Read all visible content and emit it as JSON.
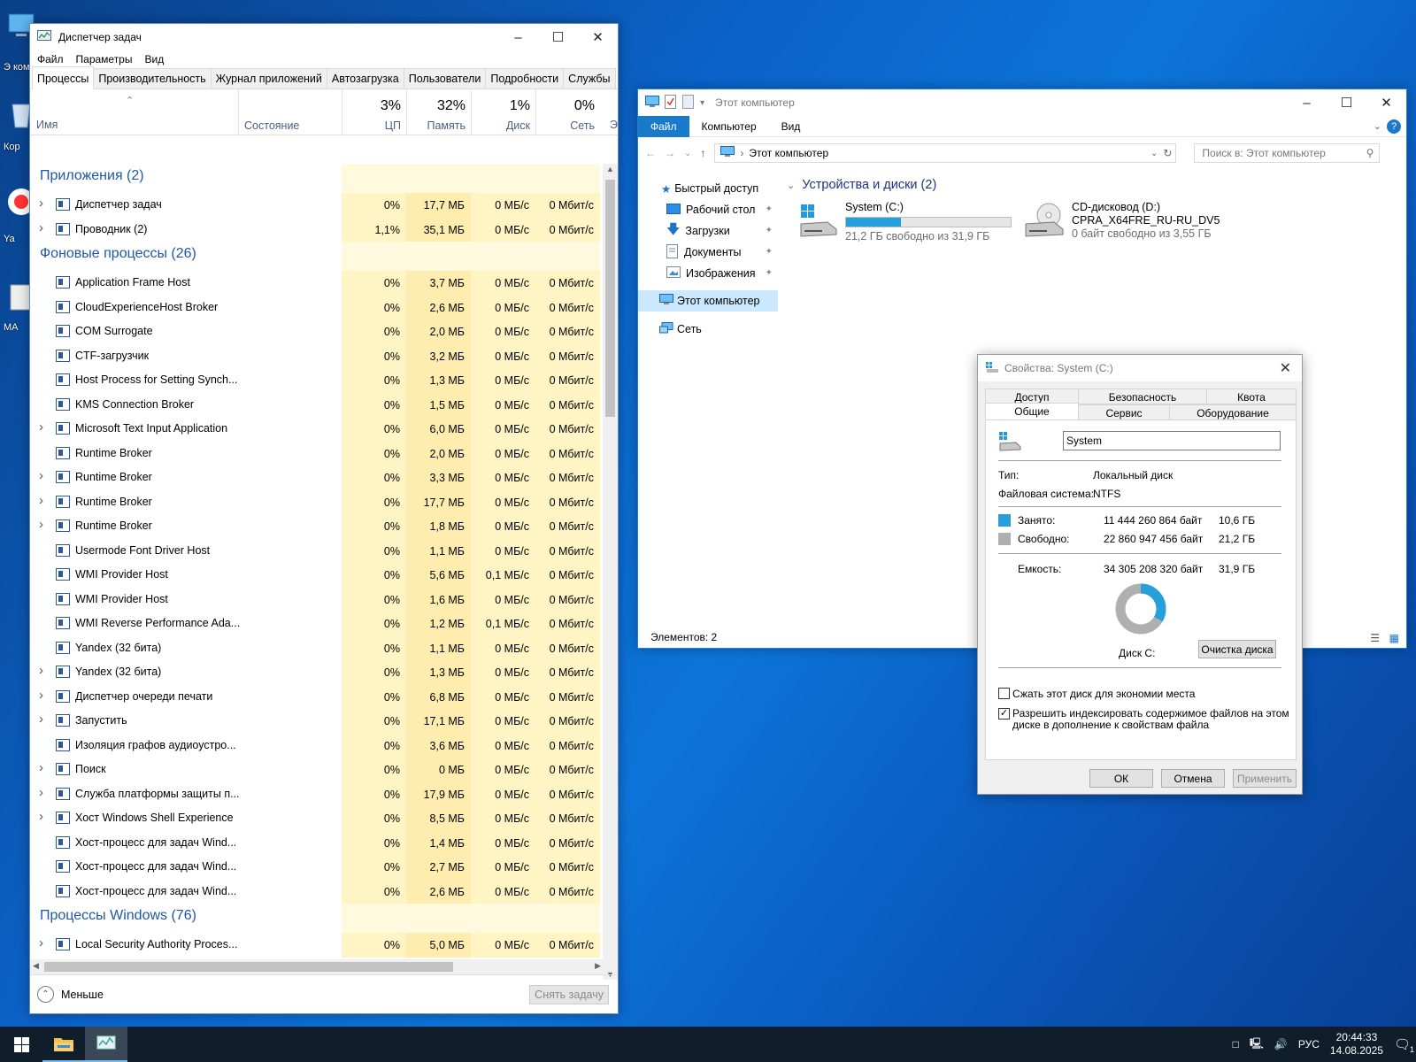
{
  "desktop": {
    "icons": [
      {
        "label": "Э комп"
      },
      {
        "label": "Кор"
      },
      {
        "label": "Ya"
      },
      {
        "label": "MA"
      }
    ]
  },
  "taskmgr": {
    "title": "Диспетчер задач",
    "menu": [
      "Файл",
      "Параметры",
      "Вид"
    ],
    "tabs": [
      "Процессы",
      "Производительность",
      "Журнал приложений",
      "Автозагрузка",
      "Пользователи",
      "Подробности",
      "Службы"
    ],
    "columns": {
      "name": "Имя",
      "status": "Состояние",
      "cpu_pct": "3%",
      "cpu": "ЦП",
      "mem_pct": "32%",
      "mem": "Память",
      "disk_pct": "1%",
      "disk": "Диск",
      "net_pct": "0%",
      "net": "Сеть",
      "more": "Э"
    },
    "groups": {
      "apps": "Приложения (2)",
      "background": "Фоновые процессы (26)",
      "windows": "Процессы Windows (76)"
    },
    "apps": [
      {
        "name": "Диспетчер задач",
        "cpu": "0%",
        "mem": "17,7 МБ",
        "disk": "0 МБ/с",
        "net": "0 Мбит/с",
        "expand": true
      },
      {
        "name": "Проводник (2)",
        "cpu": "1,1%",
        "mem": "35,1 МБ",
        "disk": "0 МБ/с",
        "net": "0 Мбит/с",
        "expand": true
      }
    ],
    "background": [
      {
        "name": "Application Frame Host",
        "cpu": "0%",
        "mem": "3,7 МБ",
        "disk": "0 МБ/с",
        "net": "0 Мбит/с",
        "expand": false
      },
      {
        "name": "CloudExperienceHost Broker",
        "cpu": "0%",
        "mem": "2,6 МБ",
        "disk": "0 МБ/с",
        "net": "0 Мбит/с",
        "expand": false
      },
      {
        "name": "COM Surrogate",
        "cpu": "0%",
        "mem": "2,0 МБ",
        "disk": "0 МБ/с",
        "net": "0 Мбит/с",
        "expand": false
      },
      {
        "name": "CTF-загрузчик",
        "cpu": "0%",
        "mem": "3,2 МБ",
        "disk": "0 МБ/с",
        "net": "0 Мбит/с",
        "expand": false
      },
      {
        "name": "Host Process for Setting Synch...",
        "cpu": "0%",
        "mem": "1,3 МБ",
        "disk": "0 МБ/с",
        "net": "0 Мбит/с",
        "expand": false
      },
      {
        "name": "KMS Connection Broker",
        "cpu": "0%",
        "mem": "1,5 МБ",
        "disk": "0 МБ/с",
        "net": "0 Мбит/с",
        "expand": false
      },
      {
        "name": "Microsoft Text Input Application",
        "cpu": "0%",
        "mem": "6,0 МБ",
        "disk": "0 МБ/с",
        "net": "0 Мбит/с",
        "expand": true
      },
      {
        "name": "Runtime Broker",
        "cpu": "0%",
        "mem": "2,0 МБ",
        "disk": "0 МБ/с",
        "net": "0 Мбит/с",
        "expand": false
      },
      {
        "name": "Runtime Broker",
        "cpu": "0%",
        "mem": "3,3 МБ",
        "disk": "0 МБ/с",
        "net": "0 Мбит/с",
        "expand": true
      },
      {
        "name": "Runtime Broker",
        "cpu": "0%",
        "mem": "17,7 МБ",
        "disk": "0 МБ/с",
        "net": "0 Мбит/с",
        "expand": true
      },
      {
        "name": "Runtime Broker",
        "cpu": "0%",
        "mem": "1,8 МБ",
        "disk": "0 МБ/с",
        "net": "0 Мбит/с",
        "expand": true
      },
      {
        "name": "Usermode Font Driver Host",
        "cpu": "0%",
        "mem": "1,1 МБ",
        "disk": "0 МБ/с",
        "net": "0 Мбит/с",
        "expand": false
      },
      {
        "name": "WMI Provider Host",
        "cpu": "0%",
        "mem": "5,6 МБ",
        "disk": "0,1 МБ/с",
        "net": "0 Мбит/с",
        "expand": false
      },
      {
        "name": "WMI Provider Host",
        "cpu": "0%",
        "mem": "1,6 МБ",
        "disk": "0 МБ/с",
        "net": "0 Мбит/с",
        "expand": false
      },
      {
        "name": "WMI Reverse Performance Ada...",
        "cpu": "0%",
        "mem": "1,2 МБ",
        "disk": "0,1 МБ/с",
        "net": "0 Мбит/с",
        "expand": false
      },
      {
        "name": "Yandex (32 бита)",
        "cpu": "0%",
        "mem": "1,1 МБ",
        "disk": "0 МБ/с",
        "net": "0 Мбит/с",
        "expand": false
      },
      {
        "name": "Yandex (32 бита)",
        "cpu": "0%",
        "mem": "1,3 МБ",
        "disk": "0 МБ/с",
        "net": "0 Мбит/с",
        "expand": true
      },
      {
        "name": "Диспетчер очереди печати",
        "cpu": "0%",
        "mem": "6,8 МБ",
        "disk": "0 МБ/с",
        "net": "0 Мбит/с",
        "expand": true
      },
      {
        "name": "Запустить",
        "cpu": "0%",
        "mem": "17,1 МБ",
        "disk": "0 МБ/с",
        "net": "0 Мбит/с",
        "expand": true
      },
      {
        "name": "Изоляция графов аудиоустро...",
        "cpu": "0%",
        "mem": "3,6 МБ",
        "disk": "0 МБ/с",
        "net": "0 Мбит/с",
        "expand": false
      },
      {
        "name": "Поиск",
        "cpu": "0%",
        "mem": "0 МБ",
        "disk": "0 МБ/с",
        "net": "0 Мбит/с",
        "expand": true
      },
      {
        "name": "Служба платформы защиты п...",
        "cpu": "0%",
        "mem": "17,9 МБ",
        "disk": "0 МБ/с",
        "net": "0 Мбит/с",
        "expand": true
      },
      {
        "name": "Хост Windows Shell Experience",
        "cpu": "0%",
        "mem": "8,5 МБ",
        "disk": "0 МБ/с",
        "net": "0 Мбит/с",
        "expand": true
      },
      {
        "name": "Хост-процесс для задач Wind...",
        "cpu": "0%",
        "mem": "1,4 МБ",
        "disk": "0 МБ/с",
        "net": "0 Мбит/с",
        "expand": false
      },
      {
        "name": "Хост-процесс для задач Wind...",
        "cpu": "0%",
        "mem": "2,7 МБ",
        "disk": "0 МБ/с",
        "net": "0 Мбит/с",
        "expand": false
      },
      {
        "name": "Хост-процесс для задач Wind...",
        "cpu": "0%",
        "mem": "2,6 МБ",
        "disk": "0 МБ/с",
        "net": "0 Мбит/с",
        "expand": false
      }
    ],
    "windows": [
      {
        "name": "Local Security Authority Proces...",
        "cpu": "0%",
        "mem": "5,0 МБ",
        "disk": "0 МБ/с",
        "net": "0 Мбит/с",
        "expand": true
      }
    ],
    "less": "Меньше",
    "end_task": "Снять задачу"
  },
  "explorer": {
    "title": "Этот компьютер",
    "ribbon": [
      "Файл",
      "Компьютер",
      "Вид"
    ],
    "address": "Этот компьютер",
    "search_placeholder": "Поиск в: Этот компьютер",
    "nav": {
      "quick_access": "Быстрый доступ",
      "pinned": [
        "Рабочий стол",
        "Загрузки",
        "Документы",
        "Изображения"
      ],
      "this_pc": "Этот компьютер",
      "network": "Сеть"
    },
    "section": "Устройства и диски (2)",
    "drives": [
      {
        "name": "System (C:)",
        "free": "21,2 ГБ свободно из 31,9 ГБ",
        "used_fraction": 0.335
      },
      {
        "name": "CD-дисковод (D:)",
        "label": "CPRA_X64FRE_RU-RU_DV5",
        "free": "0 байт свободно из 3,55 ГБ"
      }
    ],
    "status": "Элементов: 2"
  },
  "props": {
    "title": "Свойства: System (C:)",
    "tabs_top": [
      "Доступ",
      "Безопасность",
      "Квота"
    ],
    "tabs_bottom": [
      "Общие",
      "Сервис",
      "Оборудование"
    ],
    "volume_name": "System",
    "type_label": "Тип:",
    "type_value": "Локальный диск",
    "fs_label": "Файловая система:",
    "fs_value": "NTFS",
    "used_label": "Занято:",
    "used_bytes": "11 444 260 864 байт",
    "used_gb": "10,6 ГБ",
    "free_label": "Свободно:",
    "free_bytes": "22 860 947 456 байт",
    "free_gb": "21,2 ГБ",
    "cap_label": "Емкость:",
    "cap_bytes": "34 305 208 320 байт",
    "cap_gb": "31,9 ГБ",
    "disk_label": "Диск C:",
    "cleanup": "Очистка диска",
    "compress": "Сжать этот диск для экономии места",
    "index_line1": "Разрешить индексировать содержимое файлов на этом",
    "index_line2": "диске в дополнение к свойствам файла",
    "ok": "ОК",
    "cancel": "Отмена",
    "apply": "Применить",
    "used_fraction": 0.334,
    "colors": {
      "used": "#26a0da",
      "free": "#b0b0b0"
    }
  },
  "taskbar": {
    "lang": "РУС",
    "time": "20:44:33",
    "date": "14.08.2025",
    "notif_count": "1"
  }
}
